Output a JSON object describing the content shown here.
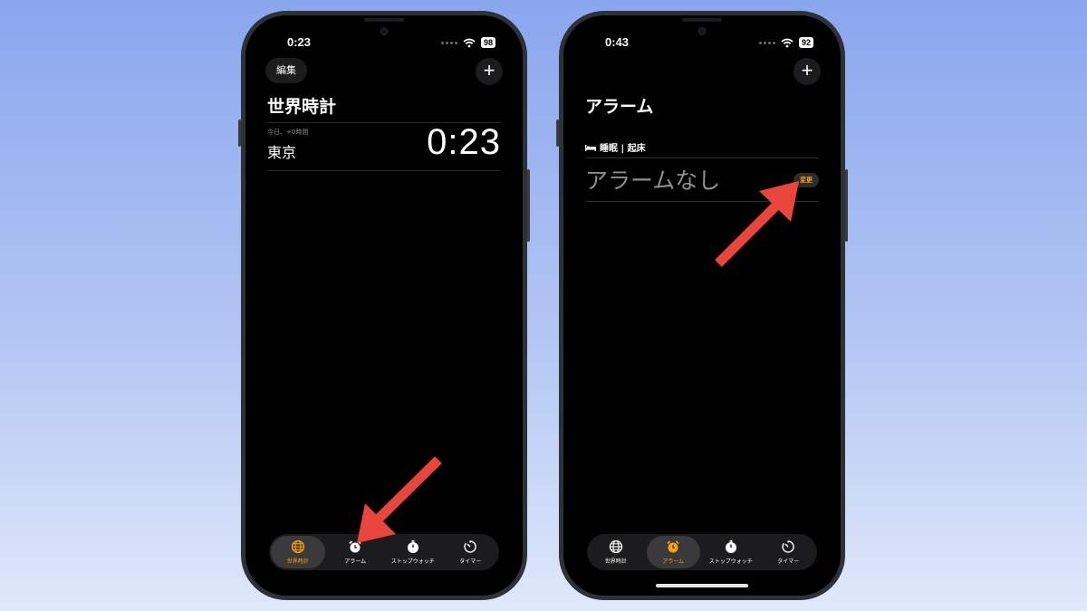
{
  "colors": {
    "accent": "#ff9f0a",
    "arrow": "#e8453c",
    "background_top": "#8aa6ee",
    "background_bottom": "#dfe8fb"
  },
  "left_phone": {
    "status": {
      "time": "0:23",
      "battery": "98"
    },
    "edit_label": "編集",
    "add_label": "+",
    "title": "世界時計",
    "clock": {
      "subtitle": "今日、+0時間",
      "city": "東京",
      "time": "0:23"
    },
    "tabs": [
      {
        "label": "世界時計",
        "icon": "globe-icon",
        "active": true
      },
      {
        "label": "アラーム",
        "icon": "alarm-clock-icon",
        "active": false
      },
      {
        "label": "ストップウォッチ",
        "icon": "stopwatch-icon",
        "active": false
      },
      {
        "label": "タイマー",
        "icon": "timer-icon",
        "active": false
      }
    ]
  },
  "right_phone": {
    "status": {
      "time": "0:43",
      "battery": "92"
    },
    "add_label": "+",
    "title": "アラーム",
    "sleep_header": "睡眠 | 起床",
    "no_alarm": "アラームなし",
    "change_label": "変更",
    "tabs": [
      {
        "label": "世界時計",
        "icon": "globe-icon",
        "active": false
      },
      {
        "label": "アラーム",
        "icon": "alarm-clock-icon",
        "active": true
      },
      {
        "label": "ストップウォッチ",
        "icon": "stopwatch-icon",
        "active": false
      },
      {
        "label": "タイマー",
        "icon": "timer-icon",
        "active": false
      }
    ]
  }
}
